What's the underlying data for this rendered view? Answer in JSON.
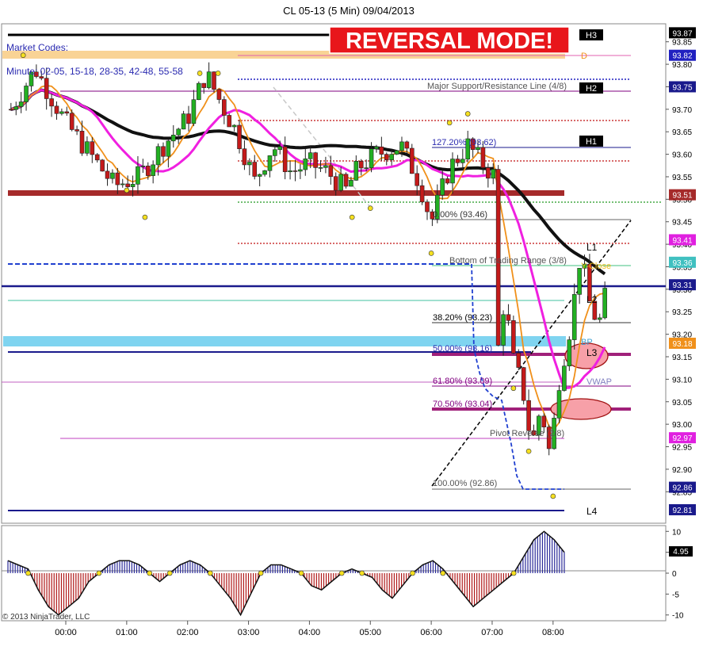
{
  "window": {
    "title": "CL 05-13 (5 Min)  09/04/2013",
    "copyright": "© 2013 NinjaTrader, LLC",
    "banner": "REVERSAL MODE!",
    "market_codes_label": "Market Codes:",
    "minute_codes": "Minute: 02-05, 15-18, 28-35, 42-48, 55-58"
  },
  "colors": {
    "banner_bg": "#e8161b",
    "up_candle": "#22b022",
    "down_candle": "#c41a1a",
    "sma_black": "#111111",
    "ema_orange": "#f0901a",
    "ema_magenta": "#f020e0",
    "osc_up": "#2b2b9a",
    "osc_down": "#b01818"
  },
  "chart_data": [
    {
      "type": "candlestick",
      "title": "CL 05-13 (5 Min)  09/04/2013",
      "x_tick_labels": [
        "00:00",
        "01:00",
        "02:00",
        "03:00",
        "04:00",
        "05:00",
        "06:00",
        "07:00",
        "08:00"
      ],
      "y_tick_labels": [
        "93.85",
        "93.80",
        "93.75",
        "93.70",
        "93.65",
        "93.60",
        "93.55",
        "93.50",
        "93.45",
        "93.40",
        "93.35",
        "93.30",
        "93.25",
        "93.20",
        "93.15",
        "93.10",
        "93.05",
        "93.00",
        "92.95",
        "92.90",
        "92.85"
      ],
      "ylim": [
        92.78,
        93.89
      ],
      "x_range_hours": [
        -0.95,
        9.85
      ],
      "series": [
        {
          "name": "close",
          "points": [
            [
              -0.9,
              93.7
            ],
            [
              -0.5,
              93.79
            ],
            [
              0.0,
              93.67
            ],
            [
              0.4,
              93.6
            ],
            [
              0.8,
              93.53
            ],
            [
              1.2,
              93.55
            ],
            [
              1.6,
              93.62
            ],
            [
              2.0,
              93.68
            ],
            [
              2.3,
              93.78
            ],
            [
              2.6,
              93.7
            ],
            [
              2.8,
              93.65
            ],
            [
              3.1,
              93.54
            ],
            [
              3.4,
              93.62
            ],
            [
              3.7,
              93.56
            ],
            [
              4.0,
              93.58
            ],
            [
              4.3,
              93.56
            ],
            [
              4.6,
              93.52
            ],
            [
              4.8,
              93.57
            ],
            [
              5.1,
              93.6
            ],
            [
              5.5,
              93.62
            ],
            [
              5.8,
              93.54
            ],
            [
              6.0,
              93.45
            ],
            [
              6.3,
              93.57
            ],
            [
              6.6,
              93.62
            ],
            [
              6.9,
              93.57
            ],
            [
              7.05,
              93.55
            ],
            [
              7.1,
              93.17
            ],
            [
              7.2,
              93.28
            ],
            [
              7.35,
              93.14
            ],
            [
              7.5,
              93.08
            ],
            [
              7.65,
              92.95
            ],
            [
              7.8,
              93.04
            ],
            [
              7.95,
              92.93
            ],
            [
              8.1,
              93.1
            ],
            [
              8.3,
              93.23
            ],
            [
              8.45,
              93.38
            ],
            [
              8.6,
              93.27
            ],
            [
              8.75,
              93.22
            ],
            [
              8.9,
              93.31
            ]
          ]
        }
      ],
      "price_labels": [
        {
          "value": "93.87",
          "color": "#000000"
        },
        {
          "value": "93.82",
          "color": "#2020c0"
        },
        {
          "value": "93.75",
          "color": "#1a1a8c"
        },
        {
          "value": "93.51",
          "color": "#a52a2a"
        },
        {
          "value": "93.41",
          "color": "#e020e0"
        },
        {
          "value": "93.36",
          "color": "#40c0c0"
        },
        {
          "value": "93.31",
          "color": "#1a1a8c"
        },
        {
          "value": "93.18",
          "color": "#f0901a"
        },
        {
          "value": "92.97",
          "color": "#e020e0"
        },
        {
          "value": "92.86",
          "color": "#1a1a8c"
        },
        {
          "value": "92.81",
          "color": "#1a1a8c"
        }
      ],
      "levels": [
        {
          "label": "H3",
          "value": 93.87
        },
        {
          "label": "H2",
          "value": 93.75
        },
        {
          "label": "H1",
          "value": 93.62
        },
        {
          "label": "L1",
          "value": 93.4
        },
        {
          "label": "L2",
          "value": 93.28
        },
        {
          "label": "L3",
          "value": 93.17
        },
        {
          "label": "L4",
          "value": 92.81
        }
      ],
      "annotations": [
        "Major Support/Resistance Line (4/8)",
        "127.20% (93.62)",
        "0.00% (93.46)",
        "Bottom of Trading Range (3/8)",
        "Y-Close",
        "38.20% (93.23)",
        "BP",
        "50.00% (93.16)",
        "61.80% (93.09)",
        "VWAP",
        "70.50% (93.04)",
        "Pivot Reverse (2/8)",
        "100.00% (92.86)",
        "D"
      ]
    },
    {
      "type": "histogram",
      "name": "oscillator",
      "y_tick_labels": [
        "10",
        "5",
        "0",
        "-5",
        "-10"
      ],
      "ylim": [
        -11,
        11
      ],
      "current_value_label": "4.95",
      "values": [
        3,
        2,
        1,
        -4,
        -8,
        -10,
        -8,
        -6,
        -2,
        0,
        2,
        3,
        3,
        2,
        0,
        -2,
        0,
        2,
        3,
        2,
        0,
        -3,
        -6,
        -10,
        -5,
        0,
        2,
        2,
        1,
        0,
        -3,
        -4,
        -2,
        0,
        1,
        0,
        -1,
        -4,
        -6,
        -3,
        0,
        2,
        3,
        1,
        -2,
        -5,
        -8,
        -6,
        -4,
        -2,
        0,
        4,
        8,
        10,
        8,
        5
      ]
    }
  ]
}
